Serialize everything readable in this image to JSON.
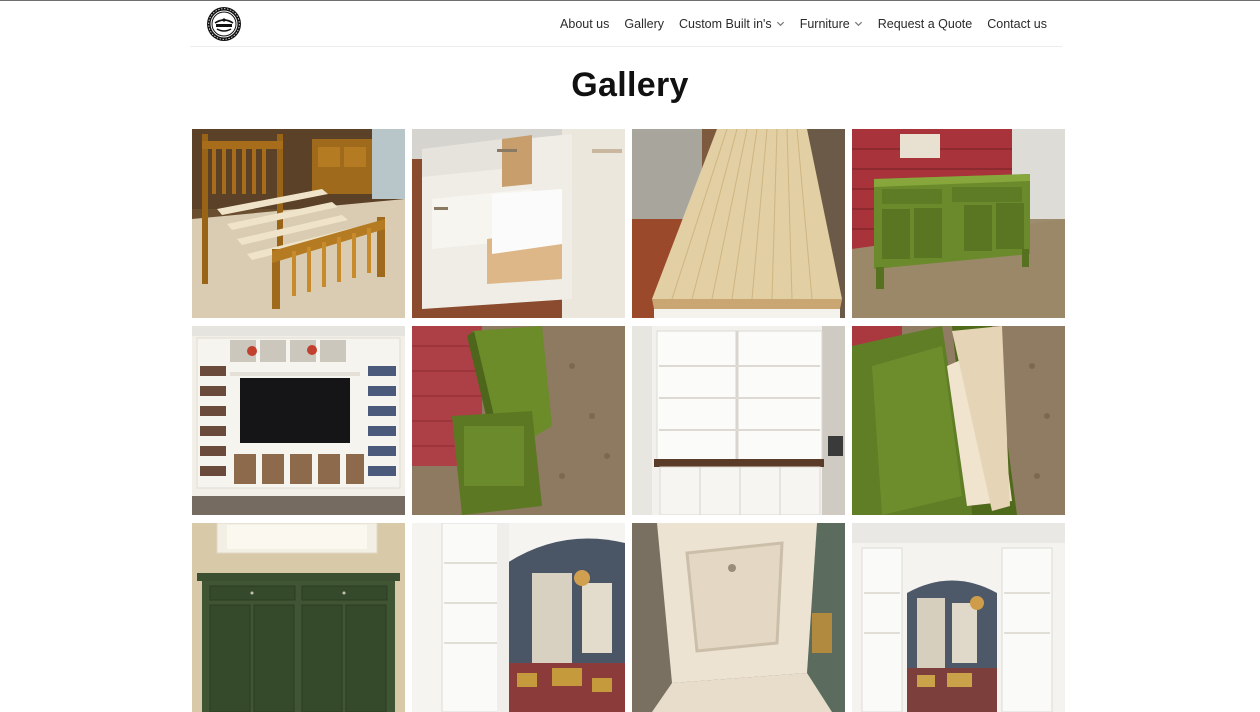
{
  "nav": {
    "items": [
      {
        "label": "About us",
        "dropdown": false
      },
      {
        "label": "Gallery",
        "dropdown": false
      },
      {
        "label": "Custom Built in's",
        "dropdown": true
      },
      {
        "label": "Furniture",
        "dropdown": true
      },
      {
        "label": "Request a Quote",
        "dropdown": false
      },
      {
        "label": "Contact us",
        "dropdown": false
      }
    ]
  },
  "page": {
    "title": "Gallery"
  },
  "gallery": {
    "photos": [
      {
        "subject": "oak slatted bed frame"
      },
      {
        "subject": "white kitchen island with pull-out bins"
      },
      {
        "subject": "butcher block countertop"
      },
      {
        "subject": "green painted sideboard outdoors"
      },
      {
        "subject": "white built-in entertainment center with bookshelves"
      },
      {
        "subject": "green painted cabinet side view"
      },
      {
        "subject": "white bookcase with dark countertop"
      },
      {
        "subject": "green cabinet with open drawer"
      },
      {
        "subject": "dark green buffet under window"
      },
      {
        "subject": "white built-in archway bookcase"
      },
      {
        "subject": "whitewashed slant-top desk"
      },
      {
        "subject": "white built-in archway bookcase with dining room"
      }
    ]
  }
}
